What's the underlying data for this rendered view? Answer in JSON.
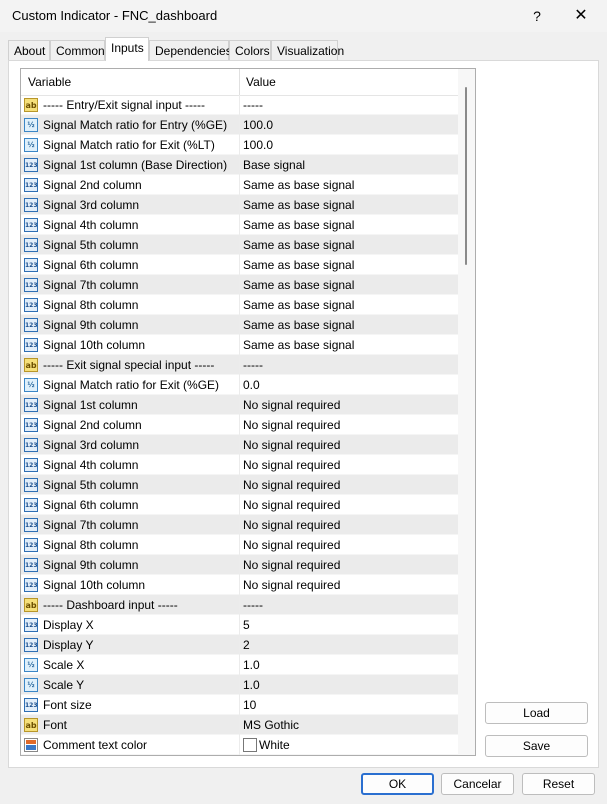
{
  "window": {
    "title": "Custom Indicator - FNC_dashboard",
    "help_label": "?",
    "close_label": "✕"
  },
  "tabs": [
    {
      "label": "About",
      "active": false
    },
    {
      "label": "Common",
      "active": false
    },
    {
      "label": "Inputs",
      "active": true
    },
    {
      "label": "Dependencies",
      "active": false
    },
    {
      "label": "Colors",
      "active": false
    },
    {
      "label": "Visualization",
      "active": false
    }
  ],
  "grid": {
    "columns": {
      "variable": "Variable",
      "value": "Value"
    },
    "rows": [
      {
        "icon": "ab",
        "variable": "----- Entry/Exit signal input -----",
        "value": "-----"
      },
      {
        "icon": "v2",
        "variable": "Signal Match ratio for Entry (%GE)",
        "value": "100.0"
      },
      {
        "icon": "v2",
        "variable": "Signal Match ratio for Exit (%LT)",
        "value": "100.0"
      },
      {
        "icon": "n123",
        "variable": "Signal 1st column (Base Direction)",
        "value": "Base signal"
      },
      {
        "icon": "n123",
        "variable": "Signal 2nd column",
        "value": "Same as base signal"
      },
      {
        "icon": "n123",
        "variable": "Signal 3rd column",
        "value": "Same as base signal"
      },
      {
        "icon": "n123",
        "variable": "Signal 4th column",
        "value": "Same as base signal"
      },
      {
        "icon": "n123",
        "variable": "Signal 5th column",
        "value": "Same as base signal"
      },
      {
        "icon": "n123",
        "variable": "Signal 6th column",
        "value": "Same as base signal"
      },
      {
        "icon": "n123",
        "variable": "Signal 7th column",
        "value": "Same as base signal"
      },
      {
        "icon": "n123",
        "variable": "Signal 8th column",
        "value": "Same as base signal"
      },
      {
        "icon": "n123",
        "variable": "Signal 9th column",
        "value": "Same as base signal"
      },
      {
        "icon": "n123",
        "variable": "Signal 10th column",
        "value": "Same as base signal"
      },
      {
        "icon": "ab",
        "variable": "----- Exit signal special input -----",
        "value": "-----"
      },
      {
        "icon": "v2",
        "variable": "Signal Match ratio for Exit (%GE)",
        "value": "0.0"
      },
      {
        "icon": "n123",
        "variable": "Signal 1st column",
        "value": "No signal required"
      },
      {
        "icon": "n123",
        "variable": "Signal 2nd column",
        "value": "No signal required"
      },
      {
        "icon": "n123",
        "variable": "Signal 3rd column",
        "value": "No signal required"
      },
      {
        "icon": "n123",
        "variable": "Signal 4th column",
        "value": "No signal required"
      },
      {
        "icon": "n123",
        "variable": "Signal 5th column",
        "value": "No signal required"
      },
      {
        "icon": "n123",
        "variable": "Signal 6th column",
        "value": "No signal required"
      },
      {
        "icon": "n123",
        "variable": "Signal 7th column",
        "value": "No signal required"
      },
      {
        "icon": "n123",
        "variable": "Signal 8th column",
        "value": "No signal required"
      },
      {
        "icon": "n123",
        "variable": "Signal 9th column",
        "value": "No signal required"
      },
      {
        "icon": "n123",
        "variable": "Signal 10th column",
        "value": "No signal required"
      },
      {
        "icon": "ab",
        "variable": "----- Dashboard input -----",
        "value": "-----"
      },
      {
        "icon": "n123",
        "variable": "Display X",
        "value": "5"
      },
      {
        "icon": "n123",
        "variable": "Display Y",
        "value": "2"
      },
      {
        "icon": "v2",
        "variable": "Scale X",
        "value": "1.0"
      },
      {
        "icon": "v2",
        "variable": "Scale Y",
        "value": "1.0"
      },
      {
        "icon": "n123",
        "variable": "Font size",
        "value": "10"
      },
      {
        "icon": "ab",
        "variable": "Font",
        "value": "MS Gothic"
      },
      {
        "icon": "color",
        "variable": "Comment text color",
        "value": "White",
        "swatch": "#ffffff"
      }
    ]
  },
  "icon_text": {
    "ab": "ab",
    "v2": "½",
    "n123": "123",
    "color": ""
  },
  "buttons": {
    "load": "Load",
    "save": "Save",
    "ok": "OK",
    "cancel": "Cancelar",
    "reset": "Reset"
  },
  "colors": {
    "accent": "#2a6fd0",
    "row_alt": "#ebebeb"
  }
}
